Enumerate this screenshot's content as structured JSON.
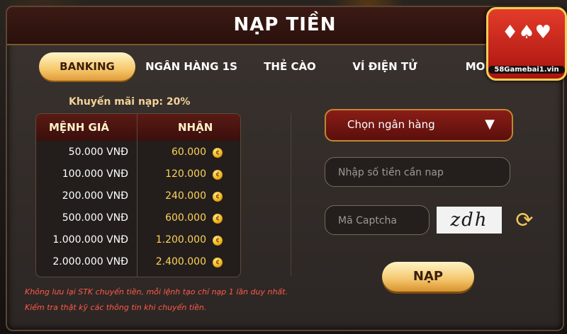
{
  "dialog": {
    "title": "NẠP TIỀN",
    "tabs": [
      {
        "label": "BANKING",
        "active": true
      },
      {
        "label": "NGÂN HÀNG 1S"
      },
      {
        "label": "THẺ CÀO"
      },
      {
        "label": "VÍ ĐIỆN TỬ"
      },
      {
        "label": "MOM"
      }
    ],
    "promo": "Khuyến mãi nạp: 20%",
    "table": {
      "headers": [
        "MỆNH GIÁ",
        "NHẬN"
      ],
      "rows": [
        {
          "amount": "50.000 VNĐ",
          "receive": "60.000"
        },
        {
          "amount": "100.000 VNĐ",
          "receive": "120.000"
        },
        {
          "amount": "200.000 VNĐ",
          "receive": "240.000"
        },
        {
          "amount": "500.000 VNĐ",
          "receive": "600.000"
        },
        {
          "amount": "1.000.000 VNĐ",
          "receive": "1.200.000"
        },
        {
          "amount": "2.000.000 VNĐ",
          "receive": "2.400.000"
        }
      ]
    },
    "form": {
      "bank_select": "Chọn ngân hàng",
      "amount_placeholder": "Nhập số tiền cần nap",
      "captcha_placeholder": "Mã Captcha",
      "captcha_text": "zdh",
      "submit": "NẠP"
    },
    "notes": [
      "Không lưu lại STK chuyển tiền, mỗi lệnh tạo chỉ nạp 1 lần duy nhất.",
      "Kiểm tra thật kỹ các thông tin khi chuyển tiền."
    ]
  },
  "logo": {
    "text": "58Gamebai1.vin",
    "icon": "playing-cards-logo"
  },
  "colors": {
    "accent": "#f4c56b",
    "header": "#3a0f0c",
    "warning": "#ff5a4a"
  }
}
